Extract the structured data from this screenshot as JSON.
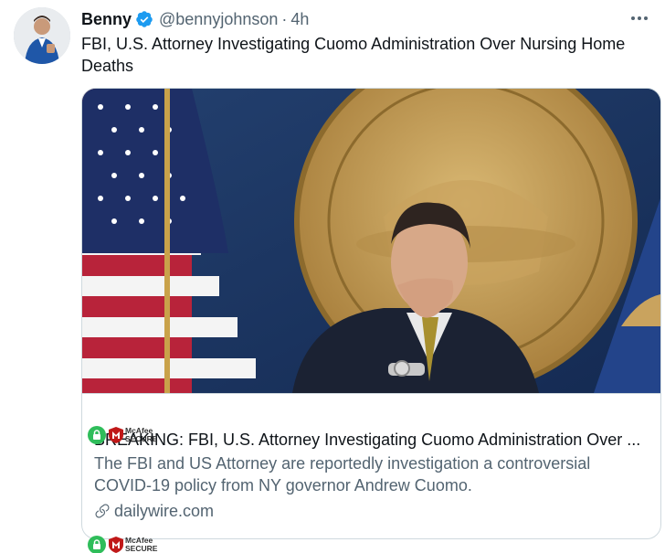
{
  "tweet": {
    "display_name": "Benny",
    "handle": "@bennyjohnson",
    "separator": "·",
    "time": "4h",
    "text": "FBI, U.S. Attorney Investigating Cuomo Administration Over Nursing Home Deaths"
  },
  "card": {
    "title": "BREAKING: FBI, U.S. Attorney Investigating Cuomo Administration Over ...",
    "description": "The FBI and US Attorney are reportedly investigation a controversial COVID-19 policy from NY governor Andrew Cuomo.",
    "domain": "dailywire.com",
    "image_alt": "Andrew Cuomo seated in front of an American flag and the Great Seal of the State of New York"
  },
  "badges": {
    "mcafee_line1": "McAfee",
    "mcafee_line2": "SECURE"
  },
  "icons": {
    "verified": "verified-badge-icon",
    "more": "more-options-icon",
    "link": "link-icon",
    "lock": "lock-icon",
    "shield": "mcafee-shield-icon"
  },
  "colors": {
    "verified_blue": "#1d9bf0",
    "secondary_text": "#536471",
    "primary_text": "#0f1419",
    "mcafee_green": "#2fbd5a",
    "mcafee_red": "#c01818"
  }
}
